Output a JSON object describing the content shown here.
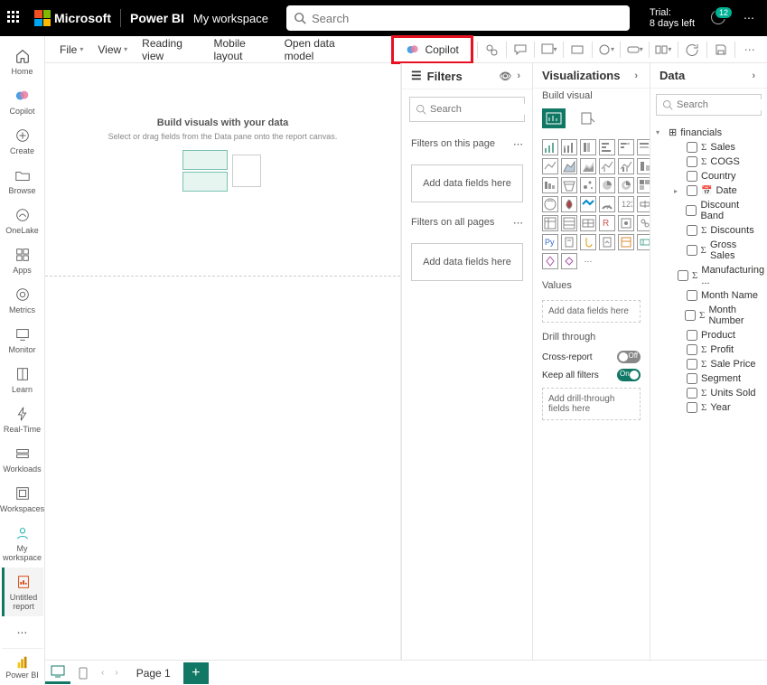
{
  "header": {
    "brand": "Microsoft",
    "product": "Power BI",
    "workspace": "My workspace",
    "search_placeholder": "Search",
    "trial_line1": "Trial:",
    "trial_line2": "8 days left",
    "notif_count": "12"
  },
  "nav": {
    "items": [
      {
        "label": "Home"
      },
      {
        "label": "Copilot"
      },
      {
        "label": "Create"
      },
      {
        "label": "Browse"
      },
      {
        "label": "OneLake"
      },
      {
        "label": "Apps"
      },
      {
        "label": "Metrics"
      },
      {
        "label": "Monitor"
      },
      {
        "label": "Learn"
      },
      {
        "label": "Real-Time"
      },
      {
        "label": "Workloads"
      },
      {
        "label": "Workspaces"
      },
      {
        "label": "My workspace"
      },
      {
        "label": "Untitled report"
      }
    ],
    "more": "...",
    "bottom": "Power BI"
  },
  "ribbon": {
    "file": "File",
    "view": "View",
    "reading": "Reading view",
    "mobile": "Mobile layout",
    "datamodel": "Open data model",
    "copilot": "Copilot"
  },
  "canvas": {
    "title": "Build visuals with your data",
    "sub": "Select or drag fields from the Data pane onto the report canvas.",
    "page_tab": "Page 1"
  },
  "filters": {
    "title": "Filters",
    "search_placeholder": "Search",
    "section_page": "Filters on this page",
    "section_all": "Filters on all pages",
    "drop": "Add data fields here"
  },
  "viz": {
    "title": "Visualizations",
    "sub": "Build visual",
    "values": "Values",
    "values_drop": "Add data fields here",
    "drill": "Drill through",
    "cross": "Cross-report",
    "cross_state": "Off",
    "keep": "Keep all filters",
    "keep_state": "On",
    "drill_drop": "Add drill-through fields here"
  },
  "data": {
    "title": "Data",
    "search_placeholder": "Search",
    "table": "financials",
    "fields": [
      {
        "name": "Sales",
        "sigma": true
      },
      {
        "name": " COGS",
        "sigma": true
      },
      {
        "name": "Country",
        "sigma": false
      },
      {
        "name": "Date",
        "sigma": false,
        "date": true,
        "twisty": true
      },
      {
        "name": "Discount Band",
        "sigma": false
      },
      {
        "name": "Discounts",
        "sigma": true
      },
      {
        "name": "Gross Sales",
        "sigma": true
      },
      {
        "name": "Manufacturing ...",
        "sigma": true
      },
      {
        "name": "Month Name",
        "sigma": false
      },
      {
        "name": "Month Number",
        "sigma": true
      },
      {
        "name": "Product",
        "sigma": false
      },
      {
        "name": "Profit",
        "sigma": true
      },
      {
        "name": "Sale Price",
        "sigma": true
      },
      {
        "name": "Segment",
        "sigma": false
      },
      {
        "name": "Units Sold",
        "sigma": true
      },
      {
        "name": "Year",
        "sigma": true
      }
    ]
  }
}
